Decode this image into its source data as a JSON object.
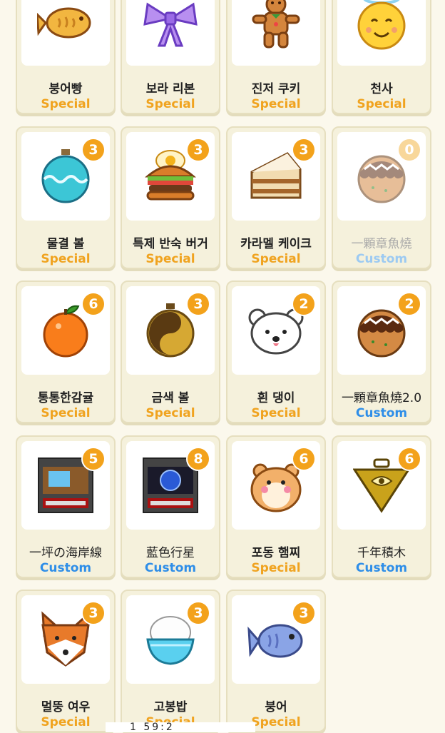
{
  "colors": {
    "special": "#f0a31f",
    "custom": "#2e8ee8",
    "badge": "#f3a21b",
    "card_bg": "#f5f1dc",
    "page_bg": "#fbf8ec"
  },
  "items": [
    {
      "name": "붕어빵",
      "type": "Special",
      "count": "",
      "icon": "taiyaki-icon"
    },
    {
      "name": "보라 리본",
      "type": "Special",
      "count": "",
      "icon": "purple-ribbon-icon"
    },
    {
      "name": "진저 쿠키",
      "type": "Special",
      "count": "",
      "icon": "gingerbread-icon"
    },
    {
      "name": "천사",
      "type": "Special",
      "count": "",
      "icon": "angel-smiley-icon"
    },
    {
      "name": "물결 볼",
      "type": "Special",
      "count": "3",
      "icon": "wave-ornament-icon"
    },
    {
      "name": "특제 반숙 버거",
      "type": "Special",
      "count": "3",
      "icon": "burger-icon"
    },
    {
      "name": "카라멜 케이크",
      "type": "Special",
      "count": "3",
      "icon": "cake-slice-icon"
    },
    {
      "name": "一顆章魚燒",
      "type": "Custom",
      "count": "0",
      "icon": "takoyaki-icon"
    },
    {
      "name": "통통한감귤",
      "type": "Special",
      "count": "6",
      "icon": "tangerine-icon"
    },
    {
      "name": "금색 볼",
      "type": "Special",
      "count": "3",
      "icon": "gold-ornament-icon"
    },
    {
      "name": "흰 댕이",
      "type": "Special",
      "count": "2",
      "icon": "white-dog-icon"
    },
    {
      "name": "一顆章魚燒2.0",
      "type": "Custom",
      "count": "2",
      "icon": "takoyaki-icon"
    },
    {
      "name": "一坪の海岸線",
      "type": "Custom",
      "count": "5",
      "icon": "retro-computer-icon"
    },
    {
      "name": "藍色行星",
      "type": "Custom",
      "count": "8",
      "icon": "retro-computer-planet-icon"
    },
    {
      "name": "포동 햄찌",
      "type": "Special",
      "count": "6",
      "icon": "hamster-icon"
    },
    {
      "name": "千年積木",
      "type": "Custom",
      "count": "6",
      "icon": "millennium-puzzle-icon"
    },
    {
      "name": "멀뚱 여우",
      "type": "Special",
      "count": "3",
      "icon": "fox-icon"
    },
    {
      "name": "고봉밥",
      "type": "Special",
      "count": "3",
      "icon": "rice-bowl-icon"
    },
    {
      "name": "붕어",
      "type": "Special",
      "count": "3",
      "icon": "fish-icon"
    }
  ],
  "status_overlay": "1         59:2"
}
